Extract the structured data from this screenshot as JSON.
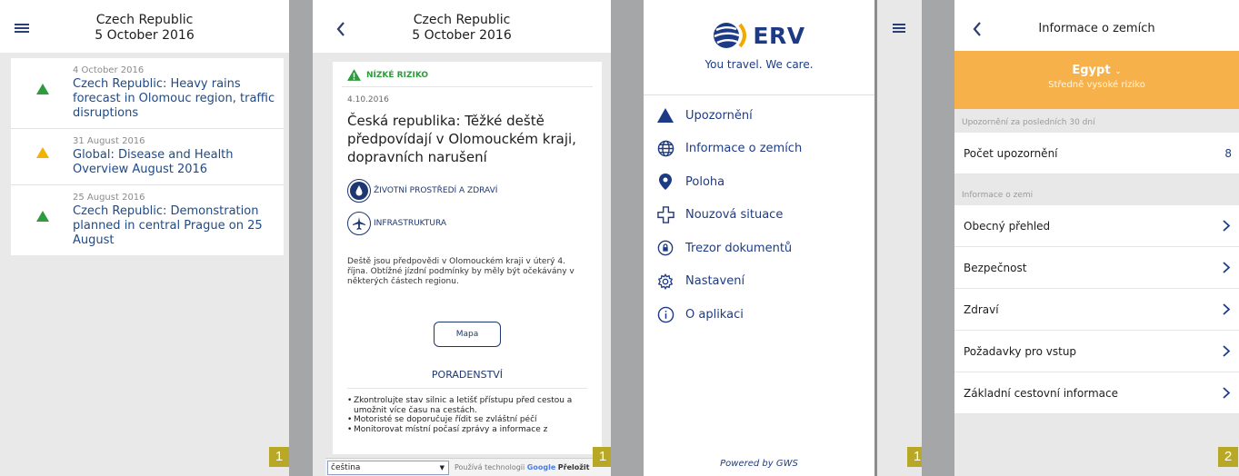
{
  "panel1": {
    "header": {
      "title_line1": "Czech Republic",
      "title_line2": "5 October 2016"
    },
    "news": [
      {
        "date": "4 October 2016",
        "headline": "Czech Republic: Heavy rains forecast in Olomouc region, traffic disruptions",
        "risk_color": "#2e9b3d"
      },
      {
        "date": "31 August 2016",
        "headline": "Global: Disease and Health Overview August 2016",
        "risk_color": "#f2b300"
      },
      {
        "date": "25 August 2016",
        "headline": "Czech Republic: Demonstration planned in central Prague on 25 August",
        "risk_color": "#2e9b3d"
      }
    ],
    "badge": "1"
  },
  "panel2": {
    "header": {
      "title_line1": "Czech Republic",
      "title_line2": "5 October 2016"
    },
    "risk_label": "NÍZKÉ RIZIKO",
    "date": "4.10.2016",
    "title": "Česká republika: Těžké deště předpovídají v Olomouckém kraji, dopravních narušení",
    "categories": [
      {
        "label": "ŽIVOTNÍ PROSTŘEDÍ A ZDRAVÍ",
        "icon": "water-drop-icon"
      },
      {
        "label": "INFRASTRUKTURA",
        "icon": "airplane-icon"
      }
    ],
    "body": "Deště jsou předpovědi v Olomouckém kraji v úterý 4. října. Obtížné jízdní podmínky by měly být očekávány v některých částech regionu.",
    "map_button": "Mapa",
    "advice_title": "PORADENSTVÍ",
    "advice": [
      "Zkontrolujte stav silnic a letišť přístupu před cestou a umožnit více času na cestách.",
      "Motoristé se doporučuje řídit se zvláštní péčí",
      "Monitorovat místní počasí zprávy a informace z"
    ],
    "language": {
      "selected": "čeština",
      "note_prefix": "Používá technologii",
      "google": "Google",
      "translate": "Přeložit"
    },
    "badge": "1"
  },
  "panel3": {
    "logo": "ERV",
    "tagline": "You travel. We care.",
    "menu": [
      {
        "label": "Upozornění",
        "icon": "warning-icon"
      },
      {
        "label": "Informace o zemích",
        "icon": "globe-icon"
      },
      {
        "label": "Poloha",
        "icon": "location-pin-icon"
      },
      {
        "label": "Nouzová situace",
        "icon": "medical-cross-icon"
      },
      {
        "label": "Trezor dokumentů",
        "icon": "document-vault-icon"
      },
      {
        "label": "Nastavení",
        "icon": "settings-gear-icon"
      },
      {
        "label": "O aplikaci",
        "icon": "info-icon"
      }
    ],
    "powered": "Powered by GWS",
    "badge": "1"
  },
  "panel4": {
    "title": "Informace o zemích",
    "country": "Egypt",
    "risk": "Středně vysoké riziko",
    "alerts_section": "Upozornění za posledních 30 dní",
    "alerts_row": {
      "label": "Počet upozornění",
      "value": "8"
    },
    "info_section": "Informace o zemi",
    "rows": [
      "Obecný přehled",
      "Bezpečnost",
      "Zdraví",
      "Požadavky pro vstup",
      "Základní cestovní informace"
    ],
    "badge": "2"
  },
  "colors": {
    "brand_blue": "#1d3b85",
    "low_risk_green": "#2e9b3d",
    "warning_yellow": "#f2b300",
    "country_banner_orange": "#f7b14a",
    "badge_olive": "#b8a826"
  }
}
